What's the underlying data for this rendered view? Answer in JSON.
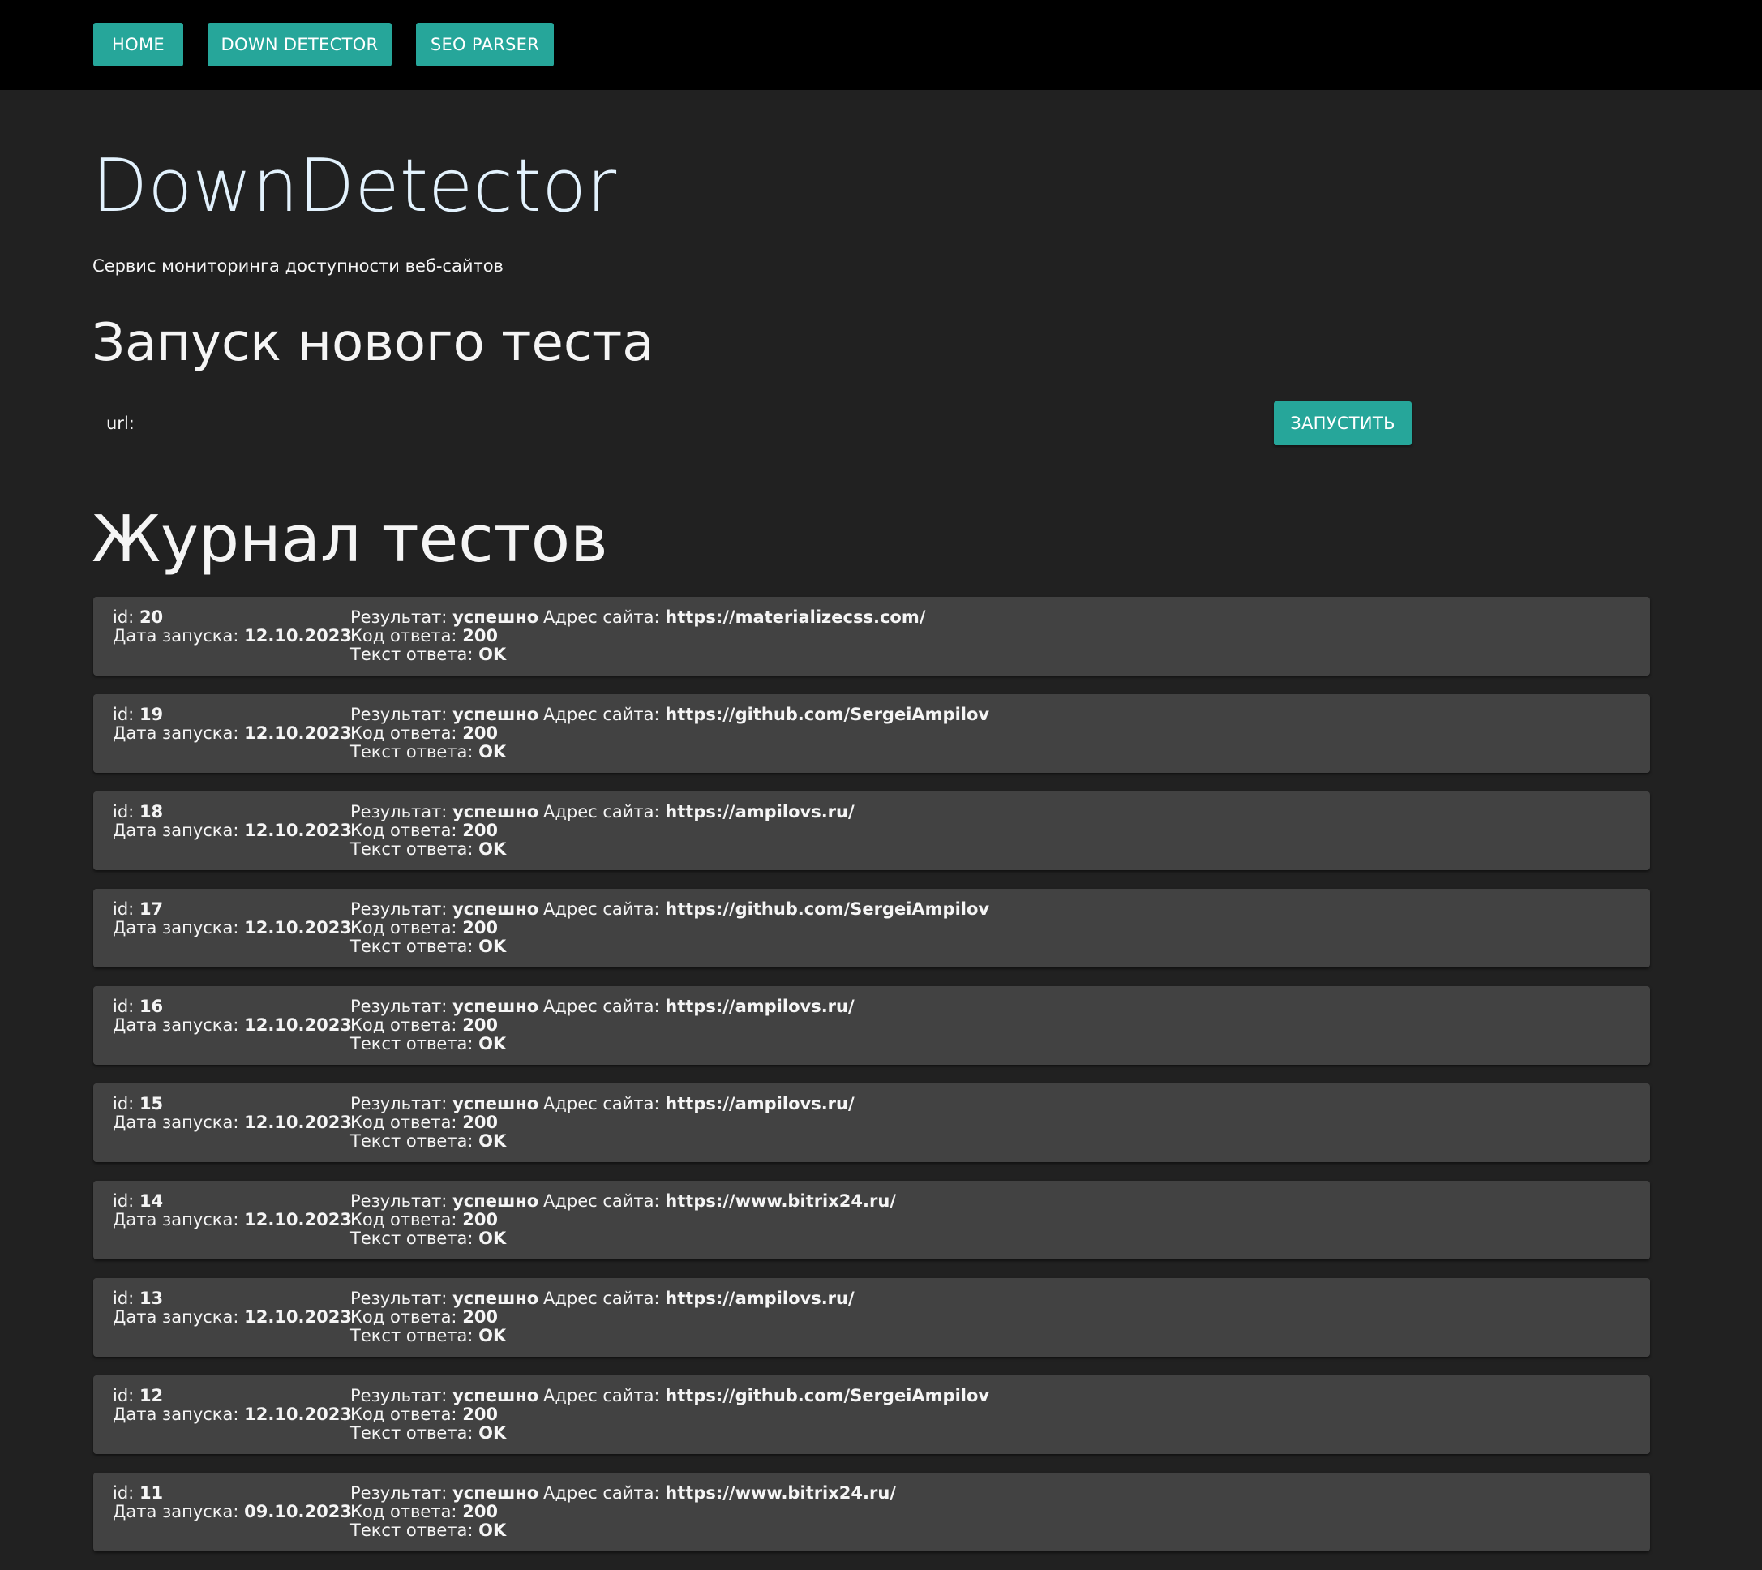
{
  "nav": {
    "home_label": "HOME",
    "down_detector_label": "DOWN DETECTOR",
    "seo_parser_label": "SEO PARSER"
  },
  "header": {
    "title": "DownDetector",
    "subtitle": "Сервис мониторинга доступности веб-сайтов"
  },
  "new_test": {
    "heading": "Запуск нового теста",
    "url_label": "url:",
    "url_value": "",
    "run_label": "ЗАПУСТИТЬ"
  },
  "log": {
    "heading": "Журнал тестов",
    "labels": {
      "id": "id:",
      "date": "Дата запуска:",
      "result": "Результат:",
      "code": "Код ответа:",
      "text": "Текст ответа:",
      "site": "Адрес сайта:"
    },
    "entries": [
      {
        "id": "20",
        "date": "12.10.2023",
        "result": "успешно",
        "code": "200",
        "text": "OK",
        "site": "https://materializecss.com/"
      },
      {
        "id": "19",
        "date": "12.10.2023",
        "result": "успешно",
        "code": "200",
        "text": "OK",
        "site": "https://github.com/SergeiAmpilov"
      },
      {
        "id": "18",
        "date": "12.10.2023",
        "result": "успешно",
        "code": "200",
        "text": "OK",
        "site": "https://ampilovs.ru/"
      },
      {
        "id": "17",
        "date": "12.10.2023",
        "result": "успешно",
        "code": "200",
        "text": "OK",
        "site": "https://github.com/SergeiAmpilov"
      },
      {
        "id": "16",
        "date": "12.10.2023",
        "result": "успешно",
        "code": "200",
        "text": "OK",
        "site": "https://ampilovs.ru/"
      },
      {
        "id": "15",
        "date": "12.10.2023",
        "result": "успешно",
        "code": "200",
        "text": "OK",
        "site": "https://ampilovs.ru/"
      },
      {
        "id": "14",
        "date": "12.10.2023",
        "result": "успешно",
        "code": "200",
        "text": "OK",
        "site": "https://www.bitrix24.ru/"
      },
      {
        "id": "13",
        "date": "12.10.2023",
        "result": "успешно",
        "code": "200",
        "text": "OK",
        "site": "https://ampilovs.ru/"
      },
      {
        "id": "12",
        "date": "12.10.2023",
        "result": "успешно",
        "code": "200",
        "text": "OK",
        "site": "https://github.com/SergeiAmpilov"
      },
      {
        "id": "11",
        "date": "09.10.2023",
        "result": "успешно",
        "code": "200",
        "text": "OK",
        "site": "https://www.bitrix24.ru/"
      }
    ]
  },
  "colors": {
    "accent": "#26a69a",
    "background": "#212121",
    "card": "#424242",
    "topbar": "#000000",
    "title": "#e3f2fd"
  }
}
